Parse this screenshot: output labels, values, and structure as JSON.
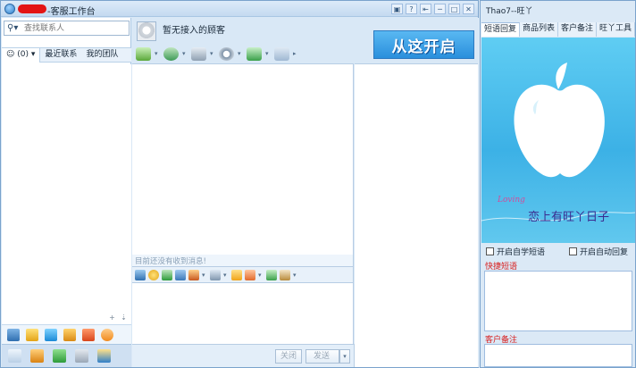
{
  "main_window": {
    "title": "-客服工作台",
    "controls": [
      "▣",
      "?",
      "⇤",
      "─",
      "□",
      "✕"
    ]
  },
  "left_panel": {
    "search_placeholder": "查找联系人",
    "tabs": [
      {
        "label": "(0)",
        "active": true
      },
      {
        "label": "最近联系",
        "active": false
      },
      {
        "label": "我的团队",
        "active": false
      }
    ],
    "mini_controls": [
      "+",
      "⇣"
    ]
  },
  "visitor": {
    "name": "暂无接入的顾客"
  },
  "promo": {
    "text": "从这开启"
  },
  "chat": {
    "status_text": "目前还没有收到消息!"
  },
  "buttons": {
    "close_label": "关闭",
    "send_label": "发送",
    "send_caret": "▾"
  },
  "side_panel": {
    "title": "Thao7--旺丫",
    "tabs": [
      {
        "label": "短语回复",
        "active": true
      },
      {
        "label": "商品列表",
        "active": false
      },
      {
        "label": "客户备注",
        "active": false
      },
      {
        "label": "旺丫工具",
        "active": false
      }
    ],
    "banner_script": "Loving",
    "banner_text": "恋上有旺丫日子",
    "option_self_learn": "开启自学短语",
    "option_auto_reply": "开启自动回复",
    "quick_phrases_label": "快捷短语",
    "customer_notes_label": "客户备注"
  },
  "colors": {
    "accent": "#2a8fdc",
    "window_bg": "#d9e8f6",
    "banner_bg": "#3cb1e6",
    "label_red": "#d81e1e",
    "redaction": "#e31414"
  }
}
